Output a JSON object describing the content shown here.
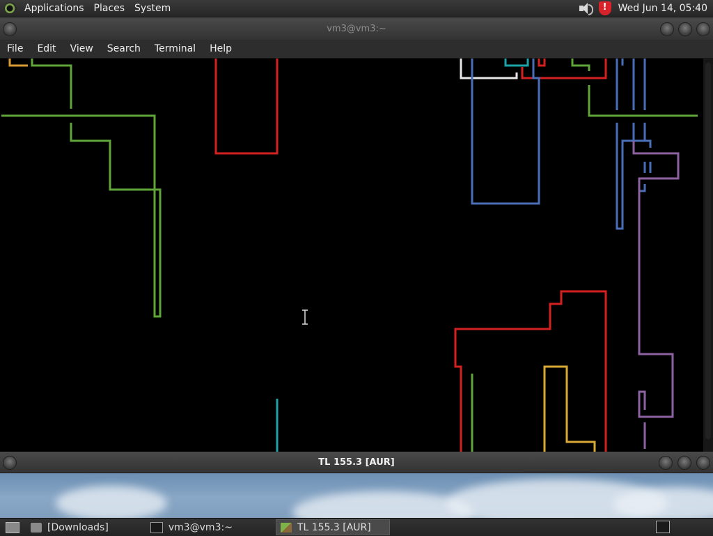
{
  "top_panel": {
    "menus": [
      "Applications",
      "Places",
      "System"
    ],
    "clock": "Wed Jun 14, 05:40",
    "tray_icons": [
      "speaker-icon",
      "shield-icon"
    ]
  },
  "terminal_window": {
    "title": "vm3@vm3:~",
    "menu": [
      "File",
      "Edit",
      "View",
      "Search",
      "Terminal",
      "Help"
    ],
    "pipe_colors": {
      "green": "#5fa53a",
      "red": "#d32020",
      "blue": "#4a6fb8",
      "teal": "#1ea3a8",
      "white": "#e6e6e6",
      "yellow": "#d9a935",
      "purple": "#8e62a0",
      "orange": "#d99a35"
    }
  },
  "second_window": {
    "title": "TL 155.3 [AUR]"
  },
  "taskbar": {
    "tasks": [
      {
        "label": "[Downloads]",
        "icon": "folder-icon"
      },
      {
        "label": "vm3@vm3:~",
        "icon": "terminal-icon"
      },
      {
        "label": "TL 155.3 [AUR]",
        "icon": "cube-icon"
      }
    ]
  }
}
